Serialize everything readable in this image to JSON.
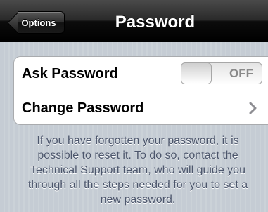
{
  "navbar": {
    "back_label": "Options",
    "title": "Password"
  },
  "settings": {
    "ask_password_label": "Ask Password",
    "ask_password_toggle_text": "OFF",
    "ask_password_enabled": false,
    "change_password_label": "Change Password"
  },
  "footer": {
    "text": "If you have forgotten your password, it is possible to reset it. To do so, contact the Technical Support team, who will guide you through all the steps needed for you to set a new password."
  },
  "icons": {
    "back": "back-arrow-icon",
    "disclosure": "chevron-right-icon"
  },
  "colors": {
    "background": "#c5ccd4",
    "navbar": "#1a1a1a",
    "footer_text": "#4c566c",
    "chevron": "#8e8e93"
  }
}
